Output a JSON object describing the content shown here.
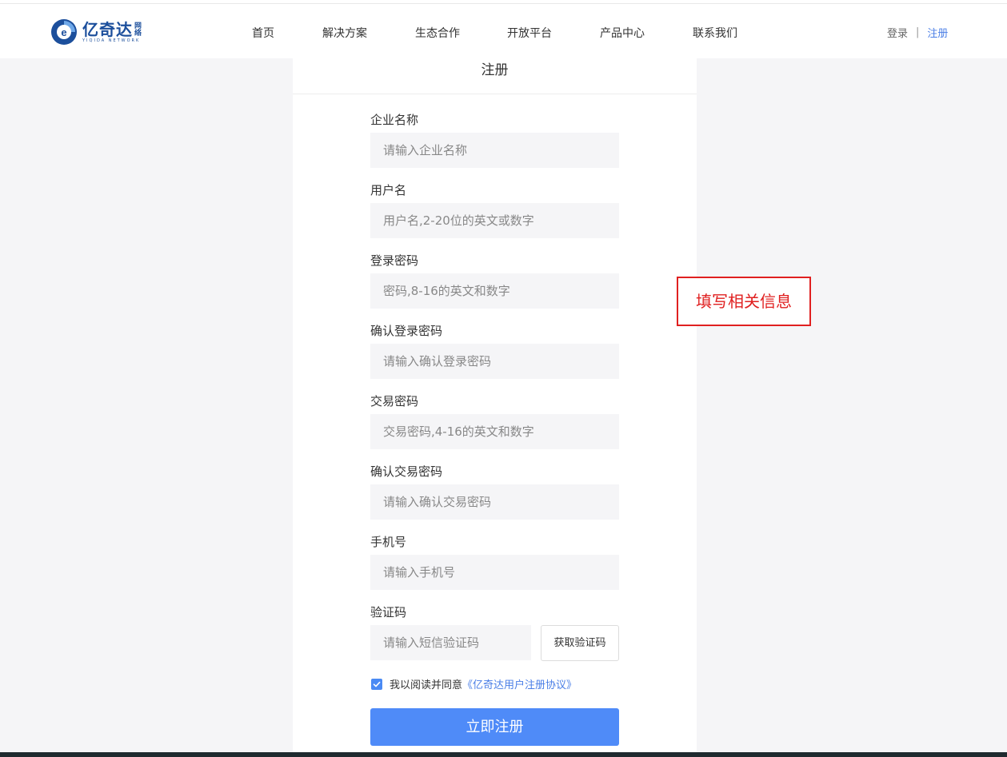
{
  "header": {
    "logo_text": "亿奇达",
    "logo_tag": "网络",
    "logo_sub": "YIQIDA NETWORK",
    "nav": [
      "首页",
      "解决方案",
      "生态合作",
      "开放平台",
      "产品中心",
      "联系我们"
    ],
    "login": "登录",
    "separator": "|",
    "register": "注册"
  },
  "form": {
    "title": "注册",
    "fields": [
      {
        "label": "企业名称",
        "placeholder": "请输入企业名称"
      },
      {
        "label": "用户名",
        "placeholder": "用户名,2-20位的英文或数字"
      },
      {
        "label": "登录密码",
        "placeholder": "密码,8-16的英文和数字"
      },
      {
        "label": "确认登录密码",
        "placeholder": "请输入确认登录密码"
      },
      {
        "label": "交易密码",
        "placeholder": "交易密码,4-16的英文和数字"
      },
      {
        "label": "确认交易密码",
        "placeholder": "请输入确认交易密码"
      },
      {
        "label": "手机号",
        "placeholder": "请输入手机号"
      },
      {
        "label": "验证码",
        "placeholder": "请输入短信验证码"
      }
    ],
    "get_code": "获取验证码",
    "agree_text": "我以阅读并同意",
    "agree_link": "《亿奇达用户注册协议》",
    "agree_checked": true,
    "submit": "立即注册"
  },
  "annotation": "填写相关信息",
  "colors": {
    "accent": "#4f8bf8",
    "link": "#4a7ee6",
    "annotation": "#e02020",
    "brand": "#1c4f9c"
  }
}
